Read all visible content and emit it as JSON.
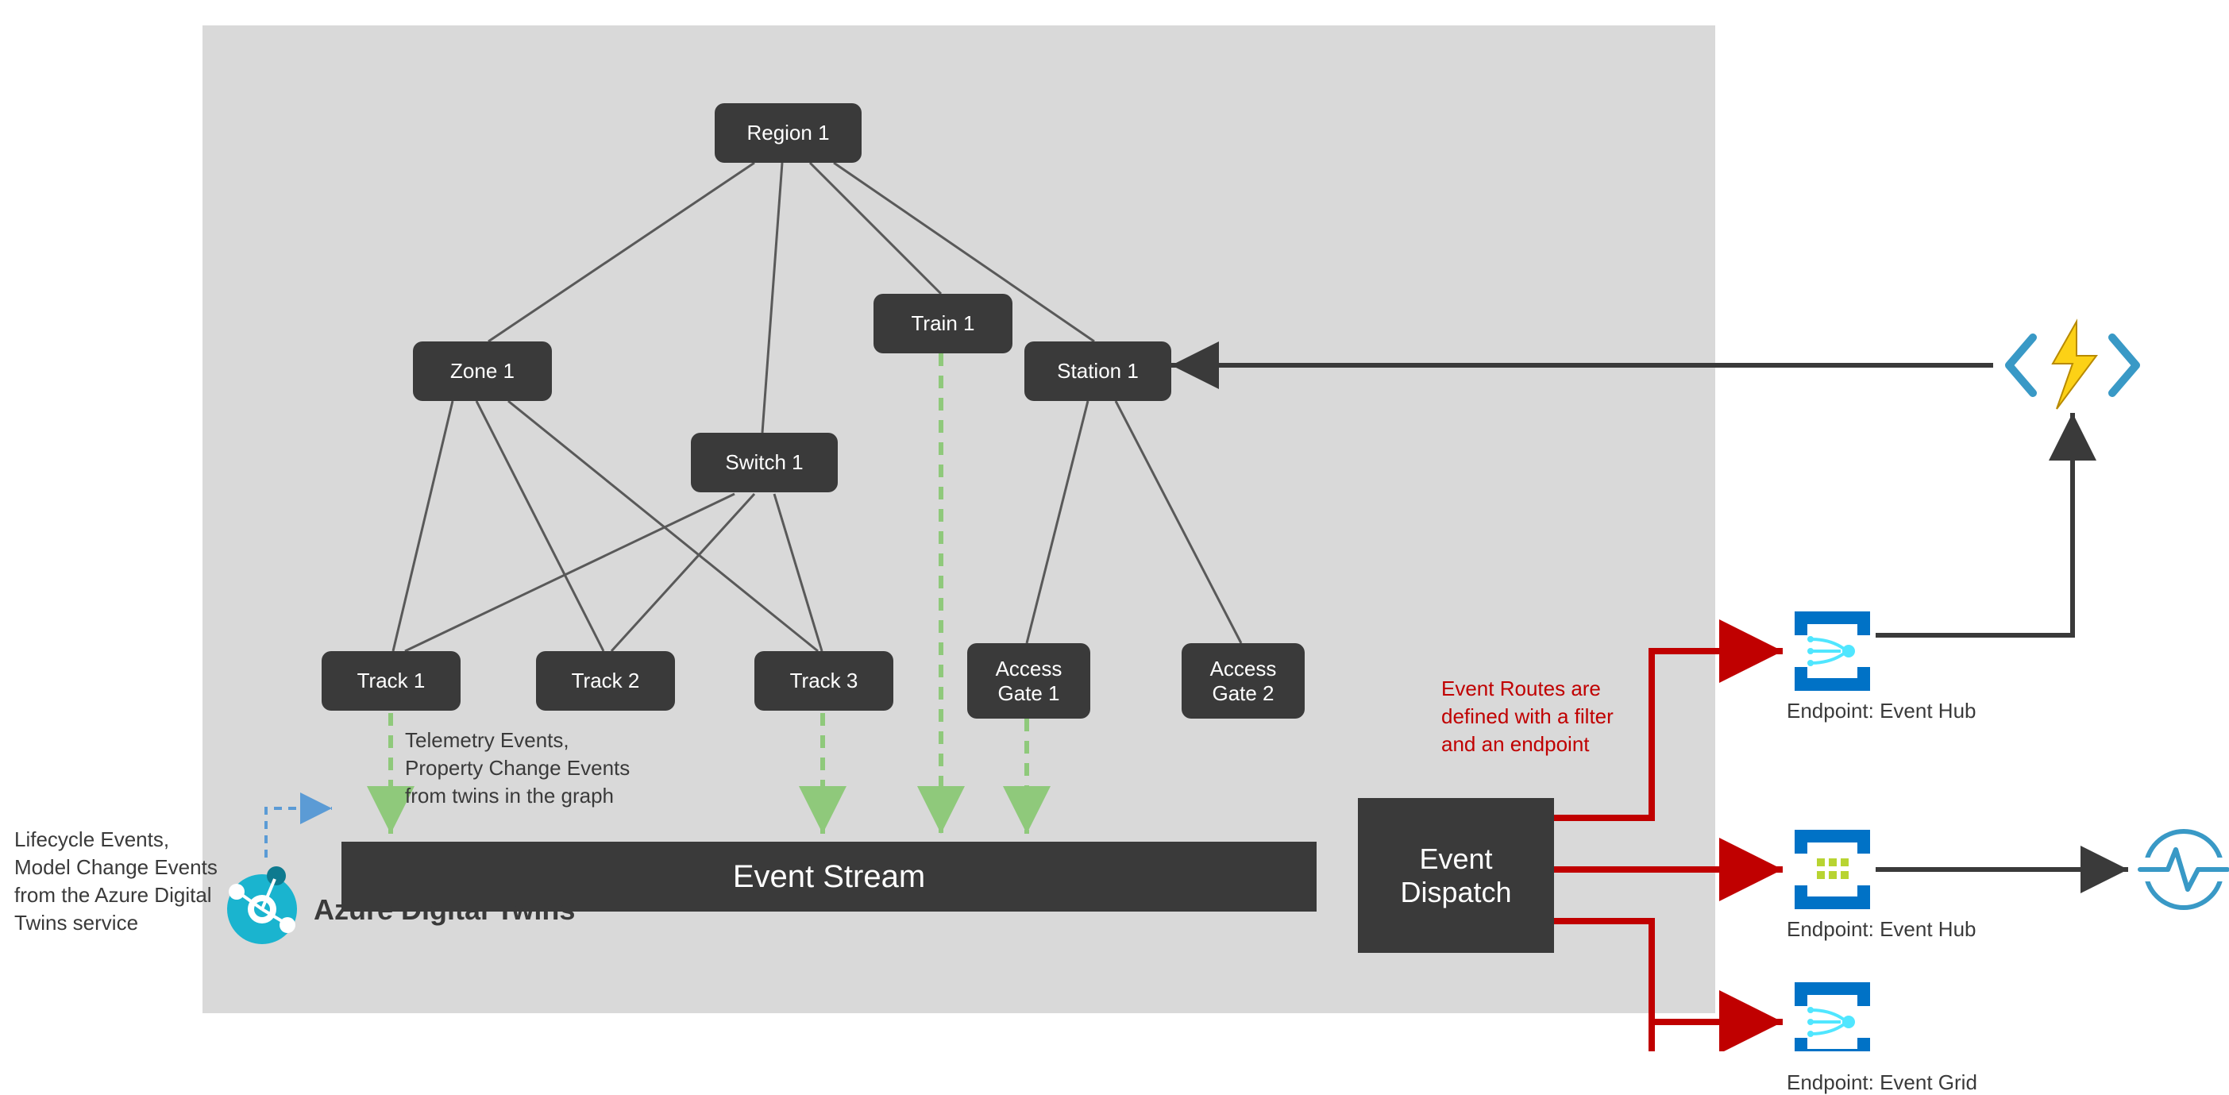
{
  "nodes": {
    "region1": "Region 1",
    "zone1": "Zone 1",
    "train1": "Train 1",
    "station1": "Station 1",
    "switch1": "Switch 1",
    "track1": "Track 1",
    "track2": "Track 2",
    "track3": "Track 3",
    "gate1": "Access\nGate 1",
    "gate2": "Access\nGate 2"
  },
  "stream": {
    "event_stream": "Event Stream",
    "event_dispatch": "Event\nDispatch"
  },
  "labels": {
    "telemetry": "Telemetry Events,\nProperty Change Events\nfrom twins in the graph",
    "lifecycle": "Lifecycle Events,\nModel Change Events\nfrom the Azure Digital\nTwins service",
    "routes": "Event Routes are\ndefined with a filter\nand an endpoint",
    "adt": "Azure Digital Twins"
  },
  "endpoints": {
    "hub1": "Endpoint: Event Hub",
    "hub2": "Endpoint: Event Hub",
    "grid": "Endpoint: Event Grid"
  },
  "colors": {
    "node_bg": "#3a3a3a",
    "canvas_bg": "#d9d9d9",
    "red": "#c00000",
    "green": "#8fc97b",
    "blue_dash": "#5b9bd5",
    "azure_blue": "#0072c6"
  }
}
